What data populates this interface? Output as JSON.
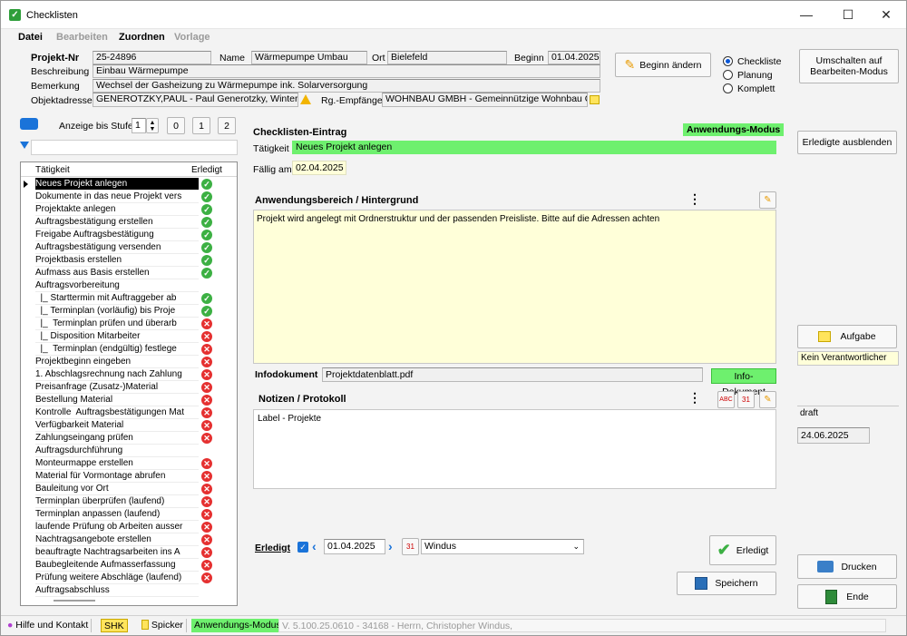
{
  "window": {
    "title": "Checklisten",
    "min": "—",
    "max": "☐",
    "close": "✕"
  },
  "menu": [
    "Datei",
    "Bearbeiten",
    "Zuordnen",
    "Vorlage"
  ],
  "project": {
    "nr_label": "Projekt-Nr",
    "nr": "25-24896",
    "name_label": "Name",
    "name": "Wärmepumpe Umbau",
    "ort_label": "Ort",
    "ort": "Bielefeld",
    "beginn_label": "Beginn",
    "beginn": "01.04.2025",
    "beschreibung_label": "Beschreibung",
    "beschreibung": "Einbau Wärmepumpe",
    "bemerkung_label": "Bemerkung",
    "bemerkung": "Wechsel der Gasheizung zu Wärmepumpe ink. Solarversorgung",
    "objektadresse_label": "Objektadresse",
    "objektadresse": "GENEROTZKY,PAUL - Paul Generotzky, Winterstr. 3",
    "rg_label": "Rg.-Empfänger",
    "rg": "WOHNBAU GMBH - Gemeinnützige Wohnbau GmbH,"
  },
  "buttons": {
    "beginn_aendern": "Beginn ändern",
    "umschalten": "Umschalten auf\nBearbeiten-Modus",
    "erledigte_ausblenden": "Erledigte ausblenden",
    "aufgabe": "Aufgabe",
    "erledigt": "Erledigt",
    "speichern": "Speichern",
    "drucken": "Drucken",
    "ende": "Ende"
  },
  "mode_radios": [
    {
      "label": "Checkliste",
      "checked": true
    },
    {
      "label": "Planung",
      "checked": false
    },
    {
      "label": "Komplett",
      "checked": false
    }
  ],
  "stufe": {
    "label": "Anzeige bis Stufe",
    "value": "1",
    "buttons": [
      "0",
      "1",
      "2"
    ]
  },
  "tree": {
    "col_taetigkeit": "Tätigkeit",
    "col_erledigt": "Erledigt",
    "rows": [
      {
        "text": "Neues Projekt anlegen",
        "status": "ok",
        "selected": true
      },
      {
        "text": "Dokumente in das neue Projekt vers",
        "status": "ok"
      },
      {
        "text": "Projektakte anlegen",
        "status": "ok"
      },
      {
        "text": "Auftragsbestätigung erstellen",
        "status": "ok"
      },
      {
        "text": "Freigabe Auftragsbestätigung",
        "status": "ok"
      },
      {
        "text": "Auftragsbestätigung versenden",
        "status": "ok"
      },
      {
        "text": "Projektbasis erstellen",
        "status": "ok"
      },
      {
        "text": "Aufmass aus Basis erstellen",
        "status": "ok"
      },
      {
        "text": "Auftragsvorbereitung",
        "status": ""
      },
      {
        "text": "  |_ Starttermin mit Auftraggeber ab",
        "status": "ok"
      },
      {
        "text": "  |_ Terminplan (vorläufig) bis Proje",
        "status": "ok"
      },
      {
        "text": "  |_  Terminplan prüfen und überarb",
        "status": "no"
      },
      {
        "text": "  |_ Disposition Mitarbeiter",
        "status": "no"
      },
      {
        "text": "  |_  Terminplan (endgültig) festlege",
        "status": "no"
      },
      {
        "text": "Projektbeginn eingeben",
        "status": "no"
      },
      {
        "text": "1. Abschlagsrechnung nach Zahlung",
        "status": "no"
      },
      {
        "text": "Preisanfrage (Zusatz-)Material",
        "status": "no"
      },
      {
        "text": "Bestellung Material",
        "status": "no"
      },
      {
        "text": "Kontrolle  Auftragsbestätigungen Mat",
        "status": "no"
      },
      {
        "text": "Verfügbarkeit Material",
        "status": "no"
      },
      {
        "text": "Zahlungseingang prüfen",
        "status": "no"
      },
      {
        "text": "Auftragsdurchführung",
        "status": ""
      },
      {
        "text": "Monteurmappe erstellen",
        "status": "no"
      },
      {
        "text": "Material für Vormontage abrufen",
        "status": "no"
      },
      {
        "text": "Bauleitung vor Ort",
        "status": "no"
      },
      {
        "text": "Terminplan überprüfen (laufend)",
        "status": "no"
      },
      {
        "text": "Terminplan anpassen (laufend)",
        "status": "no"
      },
      {
        "text": "laufende Prüfung ob Arbeiten ausser",
        "status": "no"
      },
      {
        "text": "Nachtragsangebote erstellen",
        "status": "no"
      },
      {
        "text": "beauftragte Nachtragsarbeiten ins A",
        "status": "no"
      },
      {
        "text": "Baubegleitende Aufmasserfassung",
        "status": "no"
      },
      {
        "text": "Prüfung weitere Abschläge (laufend)",
        "status": "no"
      },
      {
        "text": "Auftragsabschluss",
        "status": ""
      }
    ]
  },
  "entry": {
    "heading": "Checklisten-Eintrag",
    "mode_badge": "Anwendungs-Modus",
    "taetigkeit_label": "Tätigkeit",
    "taetigkeit": "Neues Projekt anlegen",
    "faellig_label": "Fällig am",
    "faellig": "02.04.2025",
    "anwendung_heading": "Anwendungsbereich / Hintergrund",
    "anwendung_text": "Projekt wird angelegt mit Ordnerstruktur und der passenden Preisliste. Bitte auf die Adressen achten",
    "infodok_label": "Infodokument",
    "infodok": "Projektdatenblatt.pdf",
    "infodok_badge": "Info-Dokument",
    "notizen_heading": "Notizen / Protokoll",
    "notizen_text": "Label - Projekte",
    "erledigt_label": "Erledigt",
    "erledigt_date": "01.04.2025",
    "erledigt_user": "Windus"
  },
  "right": {
    "verantwortlicher": "Kein Verantwortlicher",
    "draft": "draft",
    "date": "24.06.2025"
  },
  "statusbar": {
    "hilfe": "Hilfe und Kontakt",
    "shk": "SHK",
    "spicker": "Spicker",
    "mode": "Anwendungs-Modus",
    "version": "V. 5.100.25.0610 - 34168 - Herrn, Christopher Windus,"
  },
  "colors": {
    "green_badge": "#6ef06e",
    "yellow_field": "#ffffd9",
    "ok": "#3cb043",
    "no": "#e53030"
  }
}
